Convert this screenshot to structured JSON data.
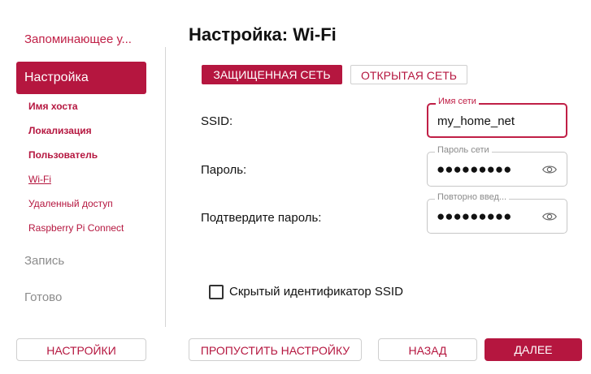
{
  "sidebar": {
    "title": "Запоминающее у...",
    "active": "Настройка",
    "subitems": [
      "Имя хоста",
      "Локализация",
      "Пользователь",
      "Wi-Fi",
      "Удаленный доступ",
      "Raspberry Pi Connect"
    ],
    "steps": [
      "Запись",
      "Готово"
    ]
  },
  "main": {
    "title": "Настройка: Wi-Fi",
    "tabs": [
      "ЗАЩИЩЕННАЯ СЕТЬ",
      "ОТКРЫТАЯ СЕТЬ"
    ],
    "ssid": {
      "label": "SSID:",
      "legend": "Имя сети",
      "value": "my_home_net"
    },
    "password": {
      "label": "Пароль:",
      "legend": "Пароль сети",
      "value": "●●●●●●●●●"
    },
    "confirm": {
      "label": "Подтвердите пароль:",
      "legend": "Повторно введ...",
      "value": "●●●●●●●●●"
    },
    "hidden_ssid_label": "Скрытый идентификатор SSID"
  },
  "footer": {
    "settings": "НАСТРОЙКИ",
    "skip": "ПРОПУСТИТЬ НАСТРОЙКУ",
    "back": "НАЗАД",
    "next": "ДАЛЕЕ"
  },
  "colors": {
    "accent": "#b5163f",
    "muted": "#8c8c8c"
  },
  "icons": {
    "show_password": "eye-icon"
  }
}
